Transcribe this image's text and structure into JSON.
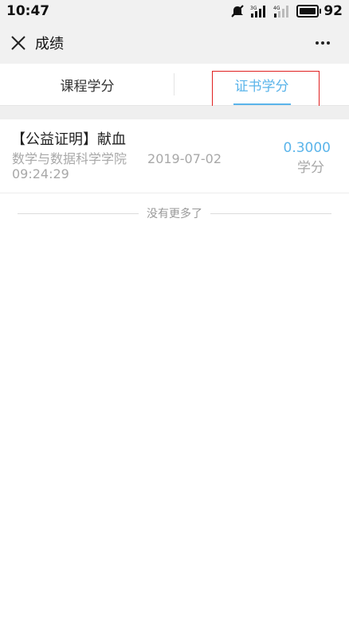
{
  "status_bar": {
    "time": "10:47",
    "battery": "92",
    "net1": "3G",
    "net2": "4G"
  },
  "nav": {
    "title": "成绩"
  },
  "tabs": [
    {
      "label": "课程学分",
      "active": false
    },
    {
      "label": "证书学分",
      "active": true
    }
  ],
  "record": {
    "title": "【公益证明】献血",
    "org": "数学与数据科学学院",
    "date": "2019-07-02",
    "time": "09:24:29",
    "points": "0.3000",
    "unit": "学分"
  },
  "footer": {
    "end_text": "没有更多了"
  },
  "colors": {
    "accent": "#5ab4ea",
    "highlight": "#e02020",
    "bar_bg": "#f1f1f1"
  },
  "icons": [
    "mute-icon",
    "signal-icon",
    "battery-icon",
    "close-icon",
    "more-icon"
  ]
}
